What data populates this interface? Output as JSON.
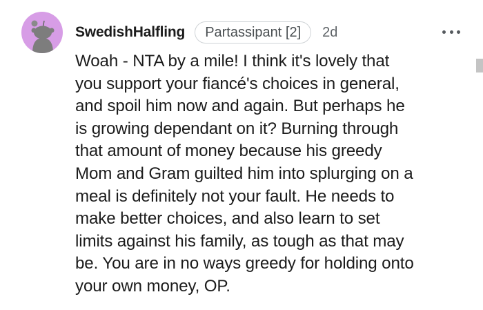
{
  "comment": {
    "username": "SwedishHalfling",
    "flair": "Partassipant [2]",
    "age": "2d",
    "lines": [
      "Woah - NTA by a mile! I think it's lovely that",
      "you support your fiancé's choices in general,",
      "and spoil him now and again. But perhaps he",
      "is growing dependant on it? Burning through",
      "that amount of money because his greedy",
      "Mom and Gram guilted him into splurging on a",
      "meal is definitely not your fault. He needs to",
      "make better choices, and also learn to set",
      "limits against his family, as tough as that may",
      "be. You are in no ways greedy for holding onto",
      "your own money, OP."
    ],
    "avatar_color": "#d79de6",
    "more_icon": "overflow-menu-icon"
  }
}
